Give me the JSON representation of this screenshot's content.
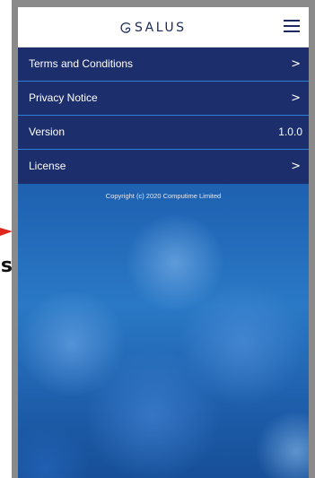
{
  "header": {
    "logo_text": "SALUS"
  },
  "menu": {
    "items": [
      {
        "label": "Terms and Conditions",
        "chevron": ">"
      },
      {
        "label": "Privacy Notice",
        "chevron": ">"
      },
      {
        "label": "Version",
        "value": "1.0.0"
      },
      {
        "label": "License",
        "chevron": ">"
      }
    ]
  },
  "footer": {
    "copyright": "Copyright (c) 2020 Computime Limited"
  },
  "callout": {
    "text": "s",
    "arrow_color": "#e0261c"
  },
  "colors": {
    "row_background": "#1c2e6b",
    "row_divider": "#2c7fd6",
    "logo": "#1a2a5e"
  }
}
